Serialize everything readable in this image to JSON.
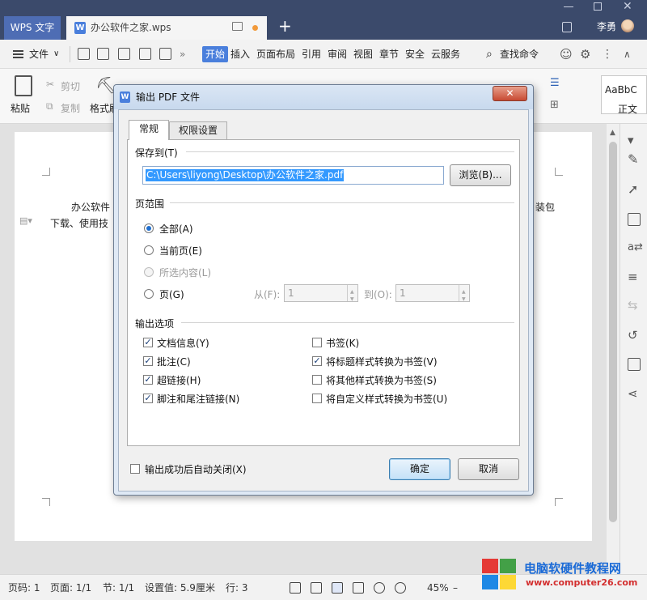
{
  "titlebar": {
    "app_tab": "WPS 文字",
    "doc_tab": "办公软件之家.wps",
    "add_tab": "+",
    "user": "李勇"
  },
  "menubar": {
    "file": "文件",
    "tabs": [
      "开始",
      "插入",
      "页面布局",
      "引用",
      "审阅",
      "视图",
      "章节",
      "安全",
      "云服务"
    ],
    "search": "查找命令"
  },
  "ribbon": {
    "paste": "粘贴",
    "cut": "剪切",
    "copy": "复制",
    "format_painter": "格式刷",
    "styles_sample": "AaBbC",
    "styles_label": "正文"
  },
  "document": {
    "line1_start": "办公软件",
    "line1_end": "装包",
    "line2_start": "下载、使用技"
  },
  "dialog": {
    "title": "输出 PDF 文件",
    "close": "✕",
    "tabs": [
      "常规",
      "权限设置"
    ],
    "save_to": {
      "label": "保存到(T)",
      "path": "C:\\Users\\liyong\\Desktop\\办公软件之家.pdf",
      "browse": "浏览(B)..."
    },
    "page_range": {
      "label": "页范围",
      "options": [
        {
          "label": "全部(A)",
          "selected": true,
          "disabled": false
        },
        {
          "label": "当前页(E)",
          "selected": false,
          "disabled": false
        },
        {
          "label": "所选内容(L)",
          "selected": false,
          "disabled": true
        },
        {
          "label": "页(G)",
          "selected": false,
          "disabled": false
        }
      ],
      "from_label": "从(F):",
      "from_value": "1",
      "to_label": "到(O):",
      "to_value": "1"
    },
    "output_options": {
      "label": "输出选项",
      "left": [
        {
          "label": "文档信息(Y)",
          "checked": true
        },
        {
          "label": "批注(C)",
          "checked": true
        },
        {
          "label": "超链接(H)",
          "checked": true
        },
        {
          "label": "脚注和尾注链接(N)",
          "checked": true
        }
      ],
      "right": [
        {
          "label": "书签(K)",
          "checked": false
        },
        {
          "label": "将标题样式转换为书签(V)",
          "checked": true
        },
        {
          "label": "将其他样式转换为书签(S)",
          "checked": false
        },
        {
          "label": "将自定义样式转换为书签(U)",
          "checked": false
        }
      ]
    },
    "auto_close": {
      "label": "输出成功后自动关闭(X)",
      "checked": false
    },
    "ok": "确定",
    "cancel": "取消"
  },
  "statusbar": {
    "page_num": "页码: 1",
    "page_count": "页面: 1/1",
    "section": "节: 1/1",
    "setting": "设置值: 5.9厘米",
    "row": "行: 3",
    "zoom": "45%",
    "zoom_minus": "–"
  },
  "watermark": {
    "title": "电脑软硬件教程网",
    "url": "www.computer26.com"
  },
  "colors": {
    "titlebar": "#3b4a6b",
    "accent": "#4a7fdc",
    "dialog_frame": "#dfe9f5",
    "selection": "#3399ff"
  }
}
